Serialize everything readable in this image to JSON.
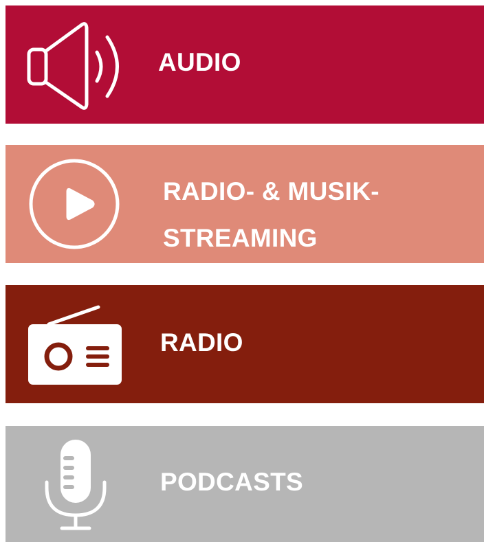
{
  "colors": {
    "audio": "#b20d36",
    "stream": "#df8a78",
    "radio": "#841e0d",
    "podcasts": "#b6b6b6",
    "text": "#ffffff"
  },
  "tiles": [
    {
      "label": "AUDIO",
      "icon": "speaker-icon"
    },
    {
      "label_line1": "RADIO- & MUSIK-",
      "label_line2": "STREAMING",
      "icon": "play-circle-icon"
    },
    {
      "label": "RADIO",
      "icon": "radio-icon"
    },
    {
      "label": "PODCASTS",
      "icon": "microphone-icon"
    }
  ]
}
